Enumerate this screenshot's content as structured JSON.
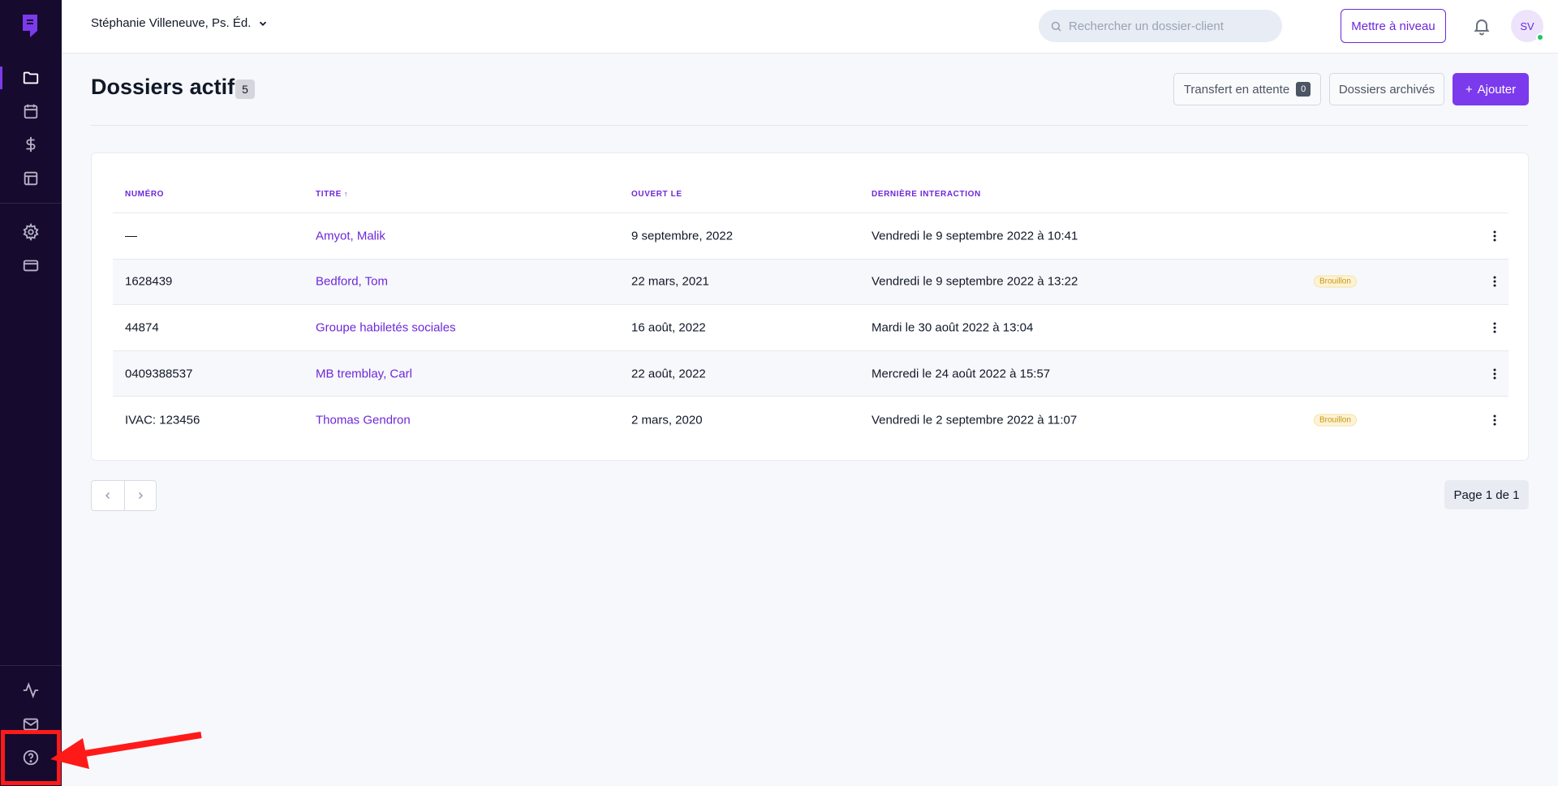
{
  "header": {
    "user_name": "Stéphanie Villeneuve, Ps. Éd.",
    "search_placeholder": "Rechercher un dossier-client",
    "upgrade_label": "Mettre à niveau",
    "avatar_initials": "SV"
  },
  "page": {
    "title": "Dossiers actifs",
    "count": "5",
    "transfer_label": "Transfert en attente",
    "transfer_count": "0",
    "archives_label": "Dossiers archivés",
    "add_label": "Ajouter",
    "add_prefix": "+"
  },
  "table": {
    "columns": [
      "Numéro",
      "Titre",
      "Ouvert le",
      "Dernière interaction"
    ],
    "sort_glyph": "↑",
    "rows": [
      {
        "numero": "—",
        "titre": "Amyot, Malik",
        "ouvert": "9 septembre, 2022",
        "interaction": "Vendredi le 9 septembre 2022 à 10:41",
        "badge": ""
      },
      {
        "numero": "1628439",
        "titre": "Bedford, Tom",
        "ouvert": "22 mars, 2021",
        "interaction": "Vendredi le 9 septembre 2022 à 13:22",
        "badge": "Brouillon"
      },
      {
        "numero": "44874",
        "titre": "Groupe habiletés sociales",
        "ouvert": "16 août, 2022",
        "interaction": "Mardi le 30 août 2022 à 13:04",
        "badge": ""
      },
      {
        "numero": "0409388537",
        "titre": "MB tremblay, Carl",
        "ouvert": "22 août, 2022",
        "interaction": "Mercredi le 24 août 2022 à 15:57",
        "badge": ""
      },
      {
        "numero": "IVAC: 123456",
        "titre": "Thomas Gendron",
        "ouvert": "2 mars, 2020",
        "interaction": "Vendredi le 2 septembre 2022 à 11:07",
        "badge": "Brouillon"
      }
    ]
  },
  "pagination": {
    "info": "Page 1 de 1"
  },
  "icons": {
    "sidebar_top": [
      "folder-icon",
      "calendar-icon",
      "dollar-icon",
      "layout-icon"
    ],
    "sidebar_mid": [
      "gear-icon",
      "credit-card-icon"
    ],
    "sidebar_bottom": [
      "activity-icon",
      "mail-icon",
      "help-icon"
    ],
    "header": [
      "chevron-down-icon",
      "search-icon",
      "bell-icon"
    ]
  },
  "colors": {
    "sidebar": "#160a2e",
    "accent": "#7c3aed",
    "badge_draft": "#c89512",
    "annotation": "#ff1a1a"
  }
}
